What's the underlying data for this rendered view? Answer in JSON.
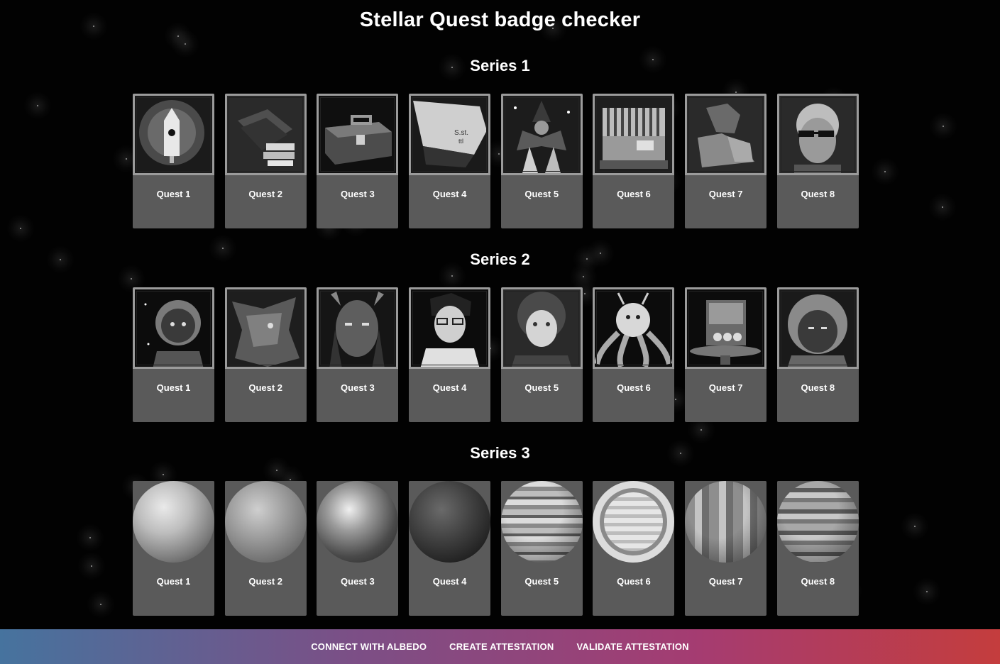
{
  "title": "Stellar Quest badge checker",
  "series": [
    {
      "title": "Series 1",
      "style": "pixel",
      "badges": [
        {
          "label": "Quest 1",
          "icon": "rocket-badge-icon"
        },
        {
          "label": "Quest 2",
          "icon": "book-badge-icon"
        },
        {
          "label": "Quest 3",
          "icon": "briefcase-badge-icon"
        },
        {
          "label": "Quest 4",
          "icon": "scroll-badge-icon"
        },
        {
          "label": "Quest 5",
          "icon": "wizard-badge-icon"
        },
        {
          "label": "Quest 6",
          "icon": "building-badge-icon"
        },
        {
          "label": "Quest 7",
          "icon": "arm-badge-icon"
        },
        {
          "label": "Quest 8",
          "icon": "sunglasses-face-badge-icon"
        }
      ]
    },
    {
      "title": "Series 2",
      "style": "pixel",
      "badges": [
        {
          "label": "Quest 1",
          "icon": "astronaut-badge-icon"
        },
        {
          "label": "Quest 2",
          "icon": "creature-badge-icon"
        },
        {
          "label": "Quest 3",
          "icon": "horned-face-badge-icon"
        },
        {
          "label": "Quest 4",
          "icon": "glasses-person-badge-icon"
        },
        {
          "label": "Quest 5",
          "icon": "curly-hair-person-badge-icon"
        },
        {
          "label": "Quest 6",
          "icon": "octopus-badge-icon"
        },
        {
          "label": "Quest 7",
          "icon": "cereal-box-badge-icon"
        },
        {
          "label": "Quest 8",
          "icon": "helmet-face-badge-icon"
        }
      ]
    },
    {
      "title": "Series 3",
      "style": "planet",
      "badges": [
        {
          "label": "Quest 1",
          "icon": "planet-rocky-icon"
        },
        {
          "label": "Quest 2",
          "icon": "planet-cloudy-icon"
        },
        {
          "label": "Quest 3",
          "icon": "planet-earthlike-icon"
        },
        {
          "label": "Quest 4",
          "icon": "planet-dark-icon"
        },
        {
          "label": "Quest 5",
          "icon": "planet-banded-icon"
        },
        {
          "label": "Quest 6",
          "icon": "planet-ringed-icon"
        },
        {
          "label": "Quest 7",
          "icon": "planet-striped-icon"
        },
        {
          "label": "Quest 8",
          "icon": "planet-mottled-icon"
        }
      ]
    }
  ],
  "footer": {
    "connect": "CONNECT WITH ALBEDO",
    "create": "CREATE ATTESTATION",
    "validate": "VALIDATE ATTESTATION"
  }
}
